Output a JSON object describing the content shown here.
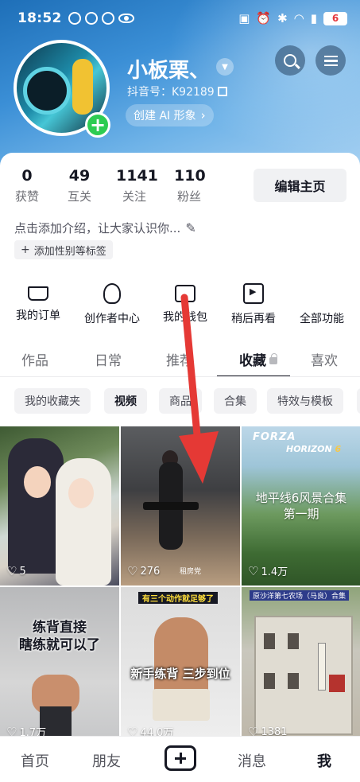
{
  "status_bar": {
    "time": "18:52",
    "battery": "6"
  },
  "profile": {
    "nickname": "小板栗、",
    "douyin_id": "抖音号：K92189",
    "ai_chip": "创建 AI 形象",
    "bio": "点击添加介绍，让大家认识你...",
    "tag_chip": "添加性别等标签",
    "edit_button": "编辑主页"
  },
  "stats": [
    {
      "value": "0",
      "label": "获赞"
    },
    {
      "value": "49",
      "label": "互关"
    },
    {
      "value": "1141",
      "label": "关注"
    },
    {
      "value": "110",
      "label": "粉丝"
    }
  ],
  "quick_actions": [
    {
      "label": "我的订单",
      "icon": "cart-icon"
    },
    {
      "label": "创作者中心",
      "icon": "lightbulb-icon"
    },
    {
      "label": "我的钱包",
      "icon": "wallet-icon"
    },
    {
      "label": "稍后再看",
      "icon": "watch-later-icon"
    },
    {
      "label": "全部功能",
      "icon": "grid-icon"
    }
  ],
  "tabs": [
    {
      "label": "作品"
    },
    {
      "label": "日常"
    },
    {
      "label": "推荐"
    },
    {
      "label": "收藏",
      "active": true,
      "locked": true
    },
    {
      "label": "喜欢"
    }
  ],
  "filters": [
    {
      "label": "我的收藏夹"
    },
    {
      "label": "视频",
      "active": true
    },
    {
      "label": "商品"
    },
    {
      "label": "合集"
    },
    {
      "label": "特效与模板"
    }
  ],
  "videos": [
    {
      "likes": "5",
      "overlay": ""
    },
    {
      "likes": "276",
      "overlay": "租房党"
    },
    {
      "likes": "1.4万",
      "overlay": "地平线6风景合集\n第一期",
      "logo_top": "FORZA",
      "logo_bottom": "HORIZON",
      "logo_num": "6"
    },
    {
      "likes": "1.7万",
      "overlay": "练背直接\n瞎练就可以了"
    },
    {
      "likes": "44.0万",
      "overlay": "新手练背 三步到位",
      "top_caption": "有三个动作就足够了"
    },
    {
      "likes": "1381",
      "overlay": "",
      "top_caption": "原沙洋第七农场（马良）合集"
    }
  ],
  "bottom_nav": [
    {
      "label": "首页"
    },
    {
      "label": "朋友"
    },
    {
      "label": "消息"
    },
    {
      "label": "我",
      "active": true
    }
  ],
  "colors": {
    "header_gradient_start": "#1e6fb8",
    "accent_green": "#2ecc52",
    "annotation_arrow": "#e53935",
    "text_primary": "#161823",
    "text_secondary": "#6e6f75"
  }
}
